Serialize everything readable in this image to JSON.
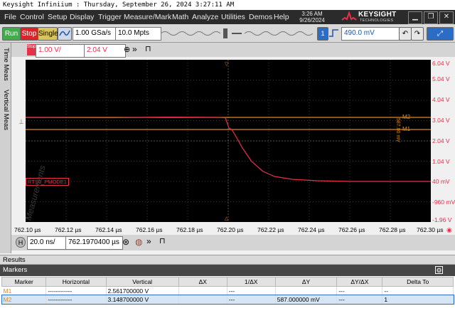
{
  "window": {
    "title": "Keysight Infiniium : Thursday, September 26, 2024 3:27:11 AM"
  },
  "menu": [
    "File",
    "Control",
    "Setup",
    "Display",
    "Trigger",
    "Measure/Mark",
    "Math",
    "Analyze",
    "Utilities",
    "Demos",
    "Help"
  ],
  "clock": {
    "time": "3:26 AM",
    "date": "9/26/2024"
  },
  "brand": {
    "name": "KEYSIGHT",
    "tagline": "TECHNOLOGIES"
  },
  "toolbar": {
    "run": "Run",
    "stop": "Stop",
    "single": "Single",
    "sample_rate": "1.00 GSa/s",
    "memory_depth": "10.0 Mpts",
    "trigger_level": "490.0 mV",
    "trigger_channel": "1"
  },
  "left_tabs": [
    "Time Meas",
    "Vertical Meas"
  ],
  "channel": {
    "label": "Stop",
    "scale": "1.00 V/",
    "offset": "2.04 V"
  },
  "plot": {
    "waveform_label": "RTS0_PMODE1",
    "delta_label": "587.00 mV",
    "m2_label": "M2",
    "m1_label": "M1",
    "watermark": "Measurements",
    "y_ticks": [
      "6.04 V",
      "5.04 V",
      "4.04 V",
      "3.04 V",
      "2.04 V",
      "1.04 V",
      "40 mV",
      "-960 mV",
      "-1.96 V"
    ],
    "x_ticks": [
      "762.10 µs",
      "762.12 µs",
      "762.14 µs",
      "762.16 µs",
      "762.18 µs",
      "762.20 µs",
      "762.22 µs",
      "762.24 µs",
      "762.26 µs",
      "762.28 µs",
      "762.30 µs"
    ]
  },
  "horizontal": {
    "label": "H",
    "scale": "20.0 ns/",
    "position": "762.1970400 µs"
  },
  "results": {
    "header": "Results",
    "tab": "Markers",
    "columns": [
      "Marker",
      "Horizontal",
      "Vertical",
      "ΔX",
      "1/ΔX",
      "ΔY",
      "ΔY/ΔX",
      "Delta To"
    ],
    "rows": [
      [
        "M1",
        "------------",
        "2.561700000 V",
        "",
        "---",
        "",
        "---",
        "--"
      ],
      [
        "M2",
        "------------",
        "3.148700000 V",
        "",
        "---",
        "587.000000 mV",
        "---",
        "1"
      ]
    ]
  },
  "colors": {
    "channel": "#e8304a",
    "marker": "#e08a1e",
    "accent": "#2b6cc4"
  }
}
